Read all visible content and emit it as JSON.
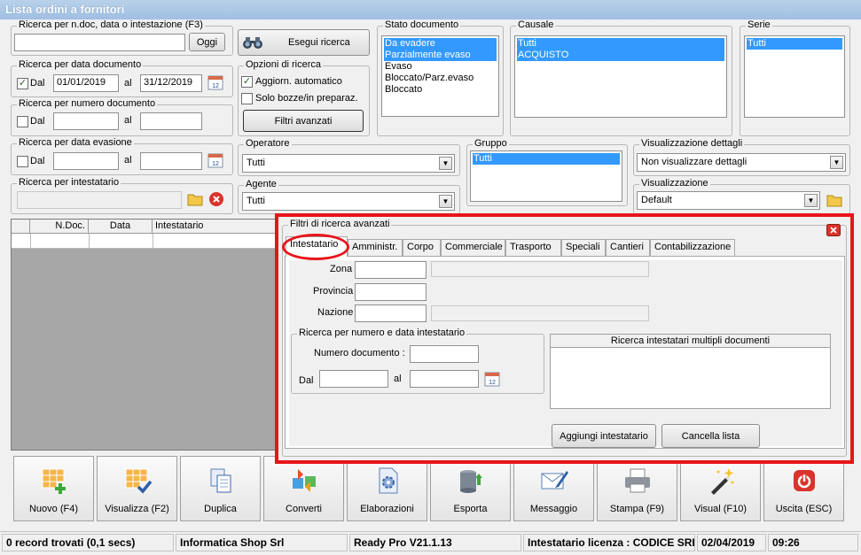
{
  "window": {
    "title": "Lista ordini a fornitori"
  },
  "search_general": {
    "label": "Ricerca per n.doc, data o intestazione (F3)",
    "value": "",
    "button": "Oggi"
  },
  "exec_search": {
    "label": "Esegui ricerca"
  },
  "date_doc": {
    "label": "Ricerca per data documento",
    "dal_label": "Dal",
    "dal_checked": true,
    "from": "01/01/2019",
    "al_label": "al",
    "to": "31/12/2019"
  },
  "num_doc": {
    "label": "Ricerca per numero documento",
    "dal_label": "Dal",
    "dal_checked": false,
    "from": "",
    "al_label": "al",
    "to": ""
  },
  "date_eva": {
    "label": "Ricerca per data evasione",
    "dal_label": "Dal",
    "dal_checked": false,
    "from": "",
    "al_label": "al",
    "to": ""
  },
  "intestatario": {
    "label": "Ricerca per intestatario",
    "value": ""
  },
  "search_options": {
    "label": "Opzioni di ricerca",
    "auto_update": "Aggiorn. automatico",
    "auto_update_checked": true,
    "only_drafts": "Solo bozze/in preparaz.",
    "only_drafts_checked": false,
    "advanced_button": "Filtri avanzati"
  },
  "stato": {
    "label": "Stato documento",
    "items": [
      {
        "text": "Da evadere",
        "selected": true
      },
      {
        "text": "Parzialmente evaso",
        "selected": true
      },
      {
        "text": "Evaso",
        "selected": false
      },
      {
        "text": "Bloccato/Parz.evaso",
        "selected": false
      },
      {
        "text": "Bloccato",
        "selected": false
      }
    ]
  },
  "causale": {
    "label": "Causale",
    "items": [
      {
        "text": "Tutti",
        "selected": true
      },
      {
        "text": "ACQUISTO",
        "selected": true
      }
    ]
  },
  "serie": {
    "label": "Serie",
    "items": [
      {
        "text": "Tutti",
        "selected": true
      }
    ]
  },
  "operatore": {
    "label": "Operatore",
    "value": "Tutti"
  },
  "agente": {
    "label": "Agente",
    "value": "Tutti"
  },
  "gruppo": {
    "label": "Gruppo",
    "items": [
      {
        "text": "Tutti",
        "selected": true
      }
    ]
  },
  "vis_dettagli": {
    "label": "Visualizzazione dettagli",
    "value": "Non visualizzare dettagli"
  },
  "visualizzazione": {
    "label": "Visualizzazione",
    "value": "Default"
  },
  "grid": {
    "columns": [
      "N.Doc.",
      "Data",
      "Intestatario"
    ]
  },
  "advanced": {
    "title": "Filtri di ricerca avanzati",
    "tabs": [
      "Intestatario",
      "Amministr.",
      "Corpo",
      "Commerciale",
      "Trasporto",
      "Speciali",
      "Cantieri",
      "Contabilizzazione"
    ],
    "active_tab": "Intestatario",
    "zona_label": "Zona",
    "zona_value": "",
    "zona_desc": "",
    "provincia_label": "Provincia",
    "provincia_value": "",
    "nazione_label": "Nazione",
    "nazione_value": "",
    "nazione_desc": "",
    "numdata": {
      "label": "Ricerca per numero e data intestatario",
      "num_label": "Numero documento :",
      "num_value": "",
      "dal_label": "Dal",
      "dal_value": "",
      "al_label": "al",
      "al_value": ""
    },
    "multi_header": "Ricerca intestatari multipli documenti",
    "add_button": "Aggiungi intestatario",
    "clear_button": "Cancella lista",
    "highlight_color": "#e8141b"
  },
  "toolbar": [
    {
      "label": "Nuovo (F4)",
      "icon": "new-grid-icon"
    },
    {
      "label": "Visualizza (F2)",
      "icon": "view-grid-icon"
    },
    {
      "label": "Duplica",
      "icon": "duplicate-icon"
    },
    {
      "label": "Converti",
      "icon": "convert-icon"
    },
    {
      "label": "Elaborazioni",
      "icon": "process-icon"
    },
    {
      "label": "Esporta",
      "icon": "export-icon"
    },
    {
      "label": "Messaggio",
      "icon": "message-icon"
    },
    {
      "label": "Stampa (F9)",
      "icon": "print-icon"
    },
    {
      "label": "Visual (F10)",
      "icon": "magic-wand-icon"
    },
    {
      "label": "Uscita (ESC)",
      "icon": "exit-icon"
    }
  ],
  "status": {
    "records": "0 record trovati (0,1 secs)",
    "company": "Informatica Shop Srl",
    "version": "Ready Pro V21.1.13",
    "license": "Intestatario licenza : CODICE SRL",
    "date": "02/04/2019",
    "time": "09:26"
  }
}
